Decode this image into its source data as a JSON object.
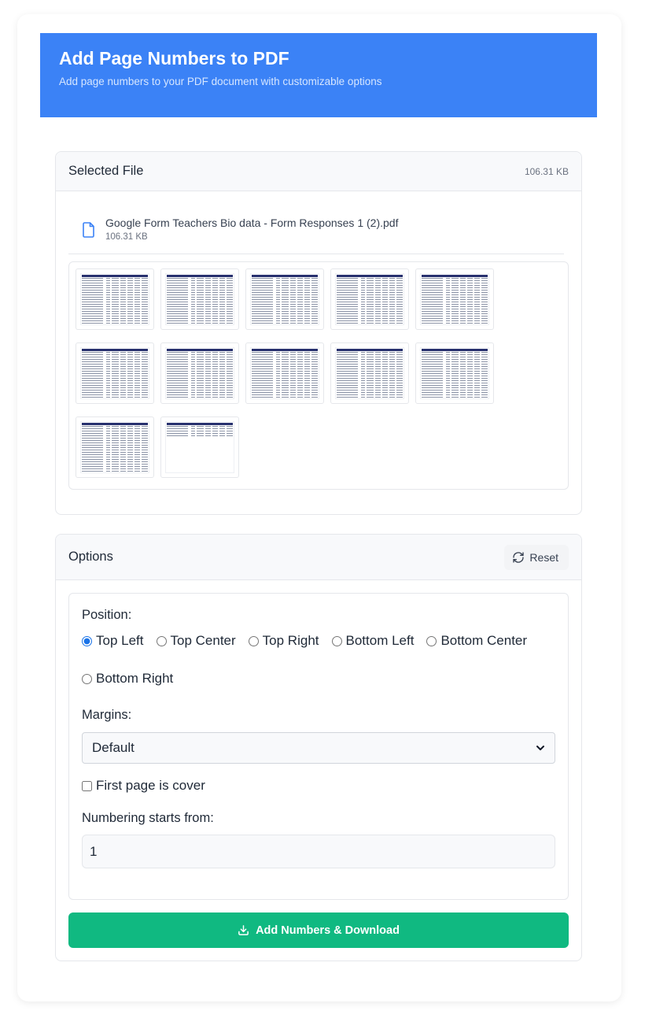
{
  "header": {
    "title": "Add Page Numbers to PDF",
    "subtitle": "Add page numbers to your PDF document with customizable options"
  },
  "file_panel": {
    "title": "Selected File",
    "total_size": "106.31 KB",
    "file": {
      "name": "Google Form Teachers Bio data - Form Responses 1 (2).pdf",
      "size": "106.31 KB",
      "icon": "file-icon"
    },
    "page_count": 12
  },
  "options_panel": {
    "title": "Options",
    "reset_label": "Reset",
    "reset_icon": "refresh-icon",
    "position_label": "Position:",
    "positions": [
      "Top Left",
      "Top Center",
      "Top Right",
      "Bottom Left",
      "Bottom Center",
      "Bottom Right"
    ],
    "selected_position": "Top Left",
    "margins_label": "Margins:",
    "margins_value": "Default",
    "cover_label": "First page is cover",
    "cover_checked": false,
    "start_label": "Numbering starts from:",
    "start_value": "1"
  },
  "submit": {
    "label": "Add Numbers & Download",
    "icon": "download-icon",
    "color": "#10b981"
  },
  "colors": {
    "header": "#3b82f6",
    "accent": "#1a73e8"
  }
}
